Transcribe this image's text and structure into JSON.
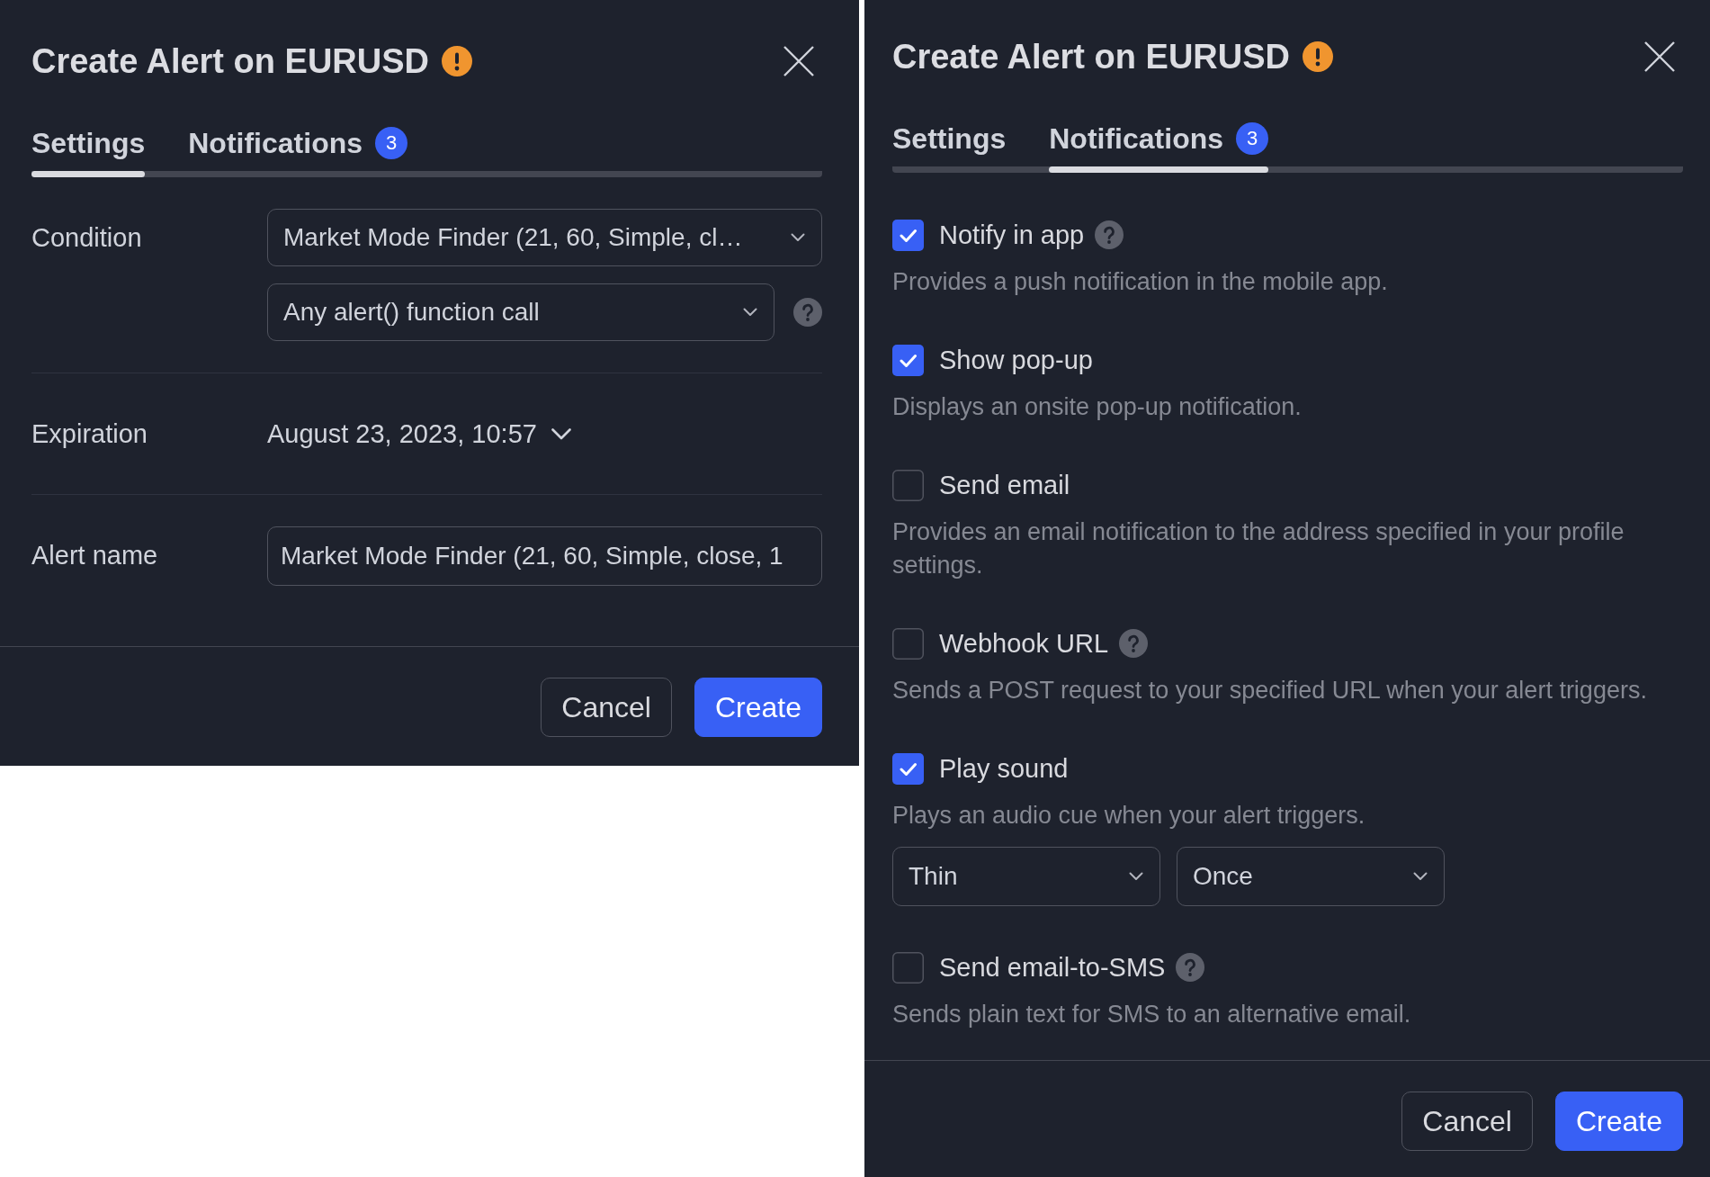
{
  "dialogs": [
    {
      "title": "Create Alert on EURUSD",
      "tabs": [
        {
          "label": "Settings",
          "selected": true
        },
        {
          "label": "Notifications",
          "selected": false,
          "badge": "3"
        }
      ],
      "content": {
        "kind": "settings",
        "rows": [
          {
            "label": "Condition",
            "kind": "selects",
            "selects": [
              {
                "value": "Market Mode Finder (21, 60, Simple, cl…",
                "help": false
              },
              {
                "value": "Any alert() function call",
                "help": true
              }
            ]
          },
          {
            "label": "Expiration",
            "kind": "date",
            "value": "August 23, 2023, 10:57"
          },
          {
            "label": "Alert name",
            "kind": "input",
            "value": "Market Mode Finder (21, 60, Simple, close, 1"
          }
        ]
      },
      "buttons": [
        {
          "label": "Cancel",
          "kind": "secondary"
        },
        {
          "label": "Create",
          "kind": "primary"
        }
      ]
    },
    {
      "title": "Create Alert on EURUSD",
      "tabs": [
        {
          "label": "Settings",
          "selected": false
        },
        {
          "label": "Notifications",
          "selected": true,
          "badge": "3"
        }
      ],
      "content": {
        "kind": "notifications",
        "options": [
          {
            "label": "Notify in app",
            "checked": true,
            "help": true,
            "description": "Provides a push notification in the mobile app."
          },
          {
            "label": "Show pop-up",
            "checked": true,
            "help": false,
            "description": "Displays an onsite pop-up notification."
          },
          {
            "label": "Send email",
            "checked": false,
            "help": false,
            "description": "Provides an email notification to the address specified in your profile settings."
          },
          {
            "label": "Webhook URL",
            "checked": false,
            "help": true,
            "description": "Sends a POST request to your specified URL when your alert triggers."
          },
          {
            "label": "Play sound",
            "checked": true,
            "help": false,
            "description": "Plays an audio cue when your alert triggers.",
            "selects": [
              "Thin",
              "Once"
            ]
          },
          {
            "label": "Send email-to-SMS",
            "checked": false,
            "help": true,
            "description": "Sends plain text for SMS to an alternative email."
          }
        ]
      },
      "buttons": [
        {
          "label": "Cancel",
          "kind": "secondary"
        },
        {
          "label": "Create",
          "kind": "primary"
        }
      ]
    }
  ]
}
